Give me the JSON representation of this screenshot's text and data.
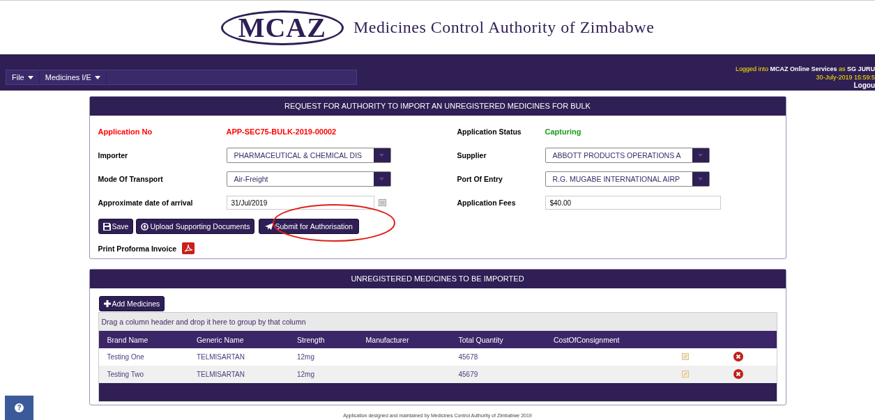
{
  "header": {
    "logo": "MCAZ",
    "title": "Medicines Control Authority of Zimbabwe"
  },
  "menu": [
    {
      "label": "File"
    },
    {
      "label": "Medicines I/E"
    }
  ],
  "session": {
    "login": "Logged into **MCAZ Online Services** as **SG JURU**",
    "datetime": "30-July-2019 15:59:5",
    "logout": "Logou"
  },
  "request_panel": {
    "title": "REQUEST FOR AUTHORITY TO IMPORT AN UNREGISTERED MEDICINES FOR BULK",
    "application_no": {
      "label": "Application No",
      "value": "APP-SEC75-BULK-2019-00002"
    },
    "application_status": {
      "label": "Application Status",
      "value": "Capturing"
    },
    "fields": [
      {
        "label": "Importer",
        "kind": "select",
        "value": "PHARMACEUTICAL & CHEMICAL DIS"
      },
      {
        "label": "Supplier",
        "kind": "select",
        "value": "ABBOTT PRODUCTS OPERATIONS A"
      },
      {
        "label": "Mode Of Transport",
        "kind": "select",
        "value": "Air-Freight"
      },
      {
        "label": "Port Of Entry",
        "kind": "select",
        "value": "R.G. MUGABE INTERNATIONAL AIRP"
      },
      {
        "label": "Approximate date of arrival",
        "kind": "date",
        "value": "31/Jul/2019"
      },
      {
        "label": "Application Fees",
        "kind": "text",
        "value": "$40.00"
      }
    ],
    "buttons": [
      {
        "label": "Save",
        "kind": "save"
      },
      {
        "label": "Upload Supporting Documents",
        "kind": "upload"
      },
      {
        "label": "Submit for Authorisation",
        "kind": "submit",
        "circled": true
      }
    ],
    "print_label": "Print Proforma Invoice"
  },
  "medicines_panel": {
    "title": "UNREGISTERED MEDICINES TO BE IMPORTED",
    "add_button": "Add Medicines",
    "group_hint": "Drag a column header and drop it here to group by that column",
    "columns": [
      "Brand Name",
      "Generic Name",
      "Strength",
      "Manufacturer",
      "Total Quantity",
      "CostOfConsignment"
    ],
    "rows": [
      [
        "Testing One",
        "TELMISARTAN",
        "12mg",
        "",
        "45678",
        ""
      ],
      [
        "Testing Two",
        "TELMISARTAN",
        "12mg",
        "",
        "45679",
        ""
      ]
    ]
  },
  "help_button": "?",
  "footer": "Application designed and maintained by Medicines Control Authority of Zimbabwe 2019"
}
